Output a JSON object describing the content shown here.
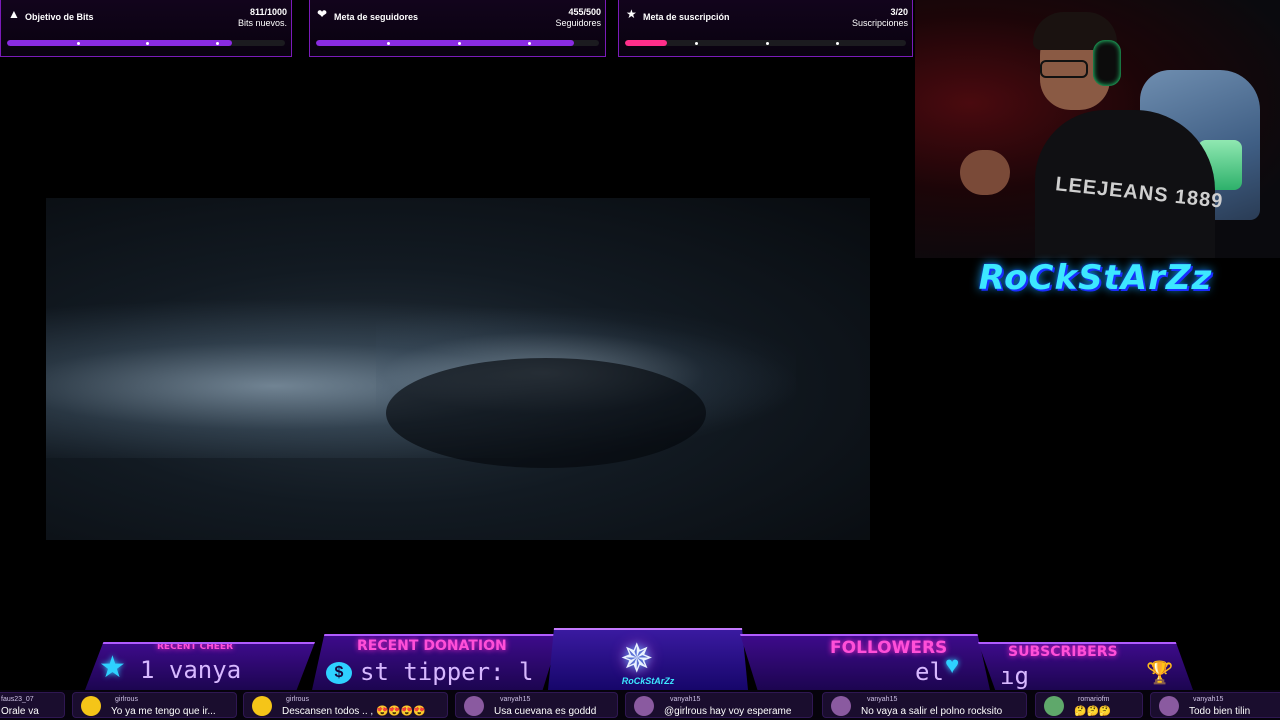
{
  "goals": [
    {
      "icon": "triangle-icon",
      "title": "Objetivo de Bits",
      "count": "811/1000",
      "subtitle": "Bits nuevos.",
      "progress": 0.81,
      "color": "#8a2be2"
    },
    {
      "icon": "heart-icon",
      "title": "Meta de seguidores",
      "count": "455/500",
      "subtitle": "Seguidores",
      "progress": 0.91,
      "color": "#8a2be2"
    },
    {
      "icon": "star-icon",
      "title": "Meta de suscripción",
      "count": "3/20",
      "subtitle": "Suscripciones",
      "progress": 0.15,
      "color": "#ff2e8a"
    }
  ],
  "webcam": {
    "shirt_text": "LEEJEANS 1889"
  },
  "brand": {
    "name": "RoCkStArZz"
  },
  "bottom_bar": {
    "recent_cheer": {
      "title": "RECENT CHEER",
      "value": "1   vanya"
    },
    "recent_donation": {
      "title": "RECENT DONATION",
      "value": "st tipper: l"
    },
    "logo_text": "RoCkStArZz",
    "followers": {
      "title": "FOLLOWERS",
      "value": "el"
    },
    "subscribers": {
      "title": "SUBSCRIBERS",
      "value": "ıg"
    }
  },
  "chat": [
    {
      "user": "faus23_07",
      "text": "Orale va",
      "avatar_color": "#6b3fa0"
    },
    {
      "user": "girlrous",
      "text": "Yo ya me tengo que ir...",
      "avatar_color": "#f5c518"
    },
    {
      "user": "girlrous",
      "text": "Descansen todos .. , 😍😍😍😍",
      "avatar_color": "#f5c518"
    },
    {
      "user": "vanyah15",
      "text": "Usa cuevana es goddd",
      "avatar_color": "#8a5aa0"
    },
    {
      "user": "vanyah15",
      "text": "@girlrous hay voy esperame",
      "avatar_color": "#8a5aa0"
    },
    {
      "user": "vanyah15",
      "text": "No vaya a salir el polno rocksito",
      "avatar_color": "#8a5aa0"
    },
    {
      "user": "romariofm",
      "text": "🤔🤔🤔",
      "avatar_color": "#5fa86b"
    },
    {
      "user": "vanyah15",
      "text": "Todo bien tilin",
      "avatar_color": "#8a5aa0"
    }
  ]
}
